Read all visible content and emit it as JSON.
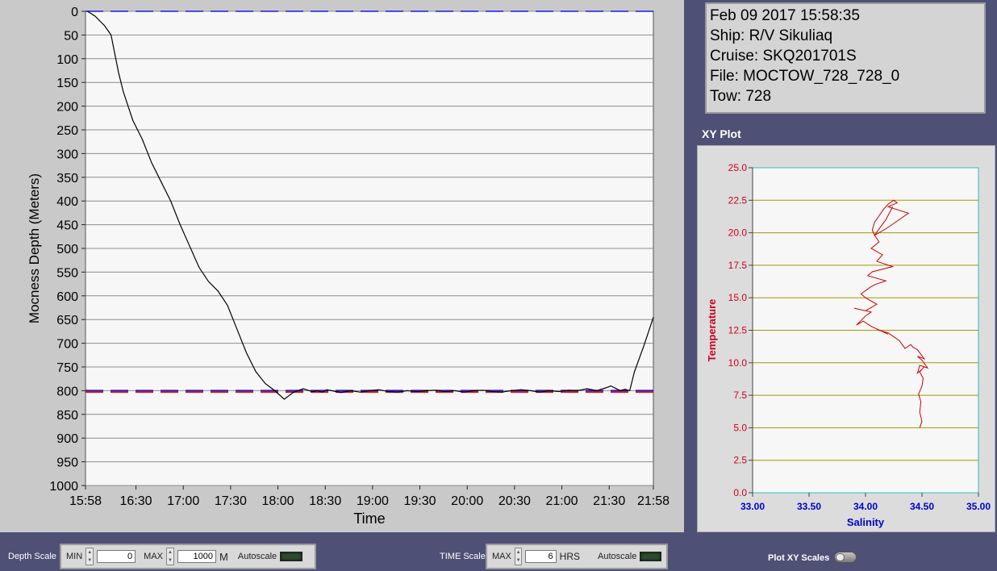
{
  "info": {
    "datetime": "Feb 09 2017 15:58:35",
    "ship": "Ship: R/V Sikuliaq",
    "cruise": "Cruise: SKQ201701S",
    "file": "File: MOCTOW_728_728_0",
    "tow": "Tow: 728"
  },
  "xy_title": "XY Plot",
  "controls": {
    "depth_scale_label": "Depth Scale",
    "min_label": "MIN",
    "min_value": "0",
    "max_label": "MAX",
    "max_value": "1000",
    "depth_unit": "M",
    "autoscale_label": "Autoscale",
    "time_scale_label": "TIME Scale",
    "time_max_label": "MAX",
    "time_max_value": "6",
    "time_unit": "HRS",
    "time_autoscale_label": "Autoscale",
    "plot_xy_scales_label": "Plot XY Scales"
  },
  "colors": {
    "panel_bg": "#4e5075",
    "plot_bg": "#f7f7f7",
    "depth_trace": "#000000",
    "target_line_blue": "#1a1ae6",
    "target_line_red": "#cc1a1a",
    "xy_trace": "#cc0000",
    "xy_grid": "#a09a00",
    "xy_y_label": "#cc0022",
    "xy_x_label": "#0000cc"
  },
  "chart_data": [
    {
      "type": "line",
      "xlabel": "Time",
      "ylabel": "Mocness Depth (Meters)",
      "ylim": [
        0,
        1000
      ],
      "y_inverted": true,
      "yticks": [
        "0",
        "50",
        "100",
        "150",
        "200",
        "250",
        "300",
        "350",
        "400",
        "450",
        "500",
        "550",
        "600",
        "650",
        "700",
        "750",
        "800",
        "850",
        "900",
        "950",
        "1000"
      ],
      "xtick_labels": [
        "15:58",
        "16:30",
        "17:00",
        "17:30",
        "18:00",
        "18:30",
        "19:00",
        "19:30",
        "20:00",
        "20:30",
        "21:00",
        "21:30",
        "21:58"
      ],
      "xtick_hours": [
        0,
        0.533,
        1.033,
        1.533,
        2.033,
        2.533,
        3.033,
        3.533,
        4.033,
        4.533,
        5.033,
        5.533,
        6.0
      ],
      "xlim_hours": [
        0,
        6
      ],
      "grid": true,
      "reference_lines": [
        {
          "depth": 0,
          "style": "dashed",
          "color": "blue"
        },
        {
          "depth": 800,
          "style": "dashed",
          "color": "blue"
        },
        {
          "depth": 803,
          "style": "dashed",
          "color": "red"
        }
      ],
      "series": [
        {
          "x_hours": [
            0.02,
            0.1,
            0.2,
            0.27,
            0.3,
            0.35,
            0.4,
            0.5,
            0.6,
            0.7,
            0.8,
            0.9,
            1.0,
            1.1,
            1.2,
            1.3,
            1.4,
            1.5,
            1.6,
            1.7,
            1.8,
            1.9,
            2.0,
            2.1,
            2.2,
            2.3,
            2.4,
            2.45,
            2.5,
            2.55,
            2.6,
            2.7,
            2.8,
            2.9,
            3.0,
            3.1,
            3.2,
            3.3,
            3.4,
            3.5,
            3.6,
            3.7,
            3.8,
            3.9,
            4.0,
            4.1,
            4.2,
            4.3,
            4.4,
            4.5,
            4.6,
            4.7,
            4.8,
            4.9,
            5.0,
            5.1,
            5.2,
            5.3,
            5.4,
            5.5,
            5.55,
            5.6,
            5.65,
            5.7,
            5.75,
            5.8,
            5.9,
            6.0
          ],
          "y_depth": [
            0,
            10,
            30,
            50,
            80,
            130,
            170,
            230,
            270,
            320,
            360,
            400,
            450,
            495,
            540,
            570,
            590,
            620,
            670,
            720,
            760,
            785,
            800,
            818,
            803,
            796,
            802,
            800,
            803,
            798,
            800,
            804,
            800,
            803,
            800,
            798,
            802,
            803,
            800,
            802,
            800,
            799,
            802,
            800,
            803,
            800,
            799,
            802,
            803,
            800,
            798,
            800,
            803,
            800,
            802,
            799,
            800,
            796,
            800,
            794,
            790,
            795,
            800,
            797,
            800,
            760,
            705,
            645
          ]
        }
      ]
    },
    {
      "type": "line",
      "xlabel": "Salinity",
      "ylabel": "Temperature",
      "xlim": [
        33.0,
        35.0
      ],
      "ylim": [
        0.0,
        25.0
      ],
      "xtick_labels": [
        "33.00",
        "33.50",
        "34.00",
        "34.50",
        "35.00"
      ],
      "ytick_labels": [
        "0.0",
        "2.5",
        "5.0",
        "7.5",
        "10.0",
        "12.5",
        "15.0",
        "17.5",
        "20.0",
        "22.5",
        "25.0"
      ],
      "series": [
        {
          "x": [
            34.48,
            34.5,
            34.48,
            34.49,
            34.47,
            34.5,
            34.51,
            34.48,
            34.52,
            34.5,
            34.46,
            34.48,
            34.55,
            34.5,
            34.46,
            34.52,
            34.46,
            34.42,
            34.4,
            34.35,
            34.3,
            34.25,
            34.2,
            34.12,
            34.1,
            34.2,
            34.05,
            33.98,
            33.92,
            34.0,
            34.05,
            33.9,
            34.0,
            34.1,
            34.0,
            33.96,
            34.04,
            34.08,
            34.18,
            34.02,
            34.06,
            34.24,
            34.1,
            34.15,
            34.05,
            34.12,
            34.08,
            34.18,
            34.38,
            34.2,
            34.28,
            34.25,
            34.2,
            34.16,
            34.12,
            34.08,
            34.06,
            34.08,
            34.12,
            34.18,
            34.24
          ],
          "y": [
            5.0,
            5.5,
            6.2,
            7.0,
            7.6,
            8.2,
            8.8,
            9.3,
            9.7,
            9.5,
            9.2,
            9.8,
            9.6,
            10.2,
            10.5,
            10.3,
            11.0,
            11.2,
            11.4,
            11.1,
            11.7,
            12.0,
            12.3,
            12.5,
            12.6,
            12.2,
            12.8,
            13.2,
            12.9,
            13.6,
            13.9,
            14.2,
            14.0,
            14.5,
            15.0,
            15.3,
            15.8,
            16.0,
            16.3,
            16.7,
            17.0,
            17.4,
            17.8,
            18.3,
            18.8,
            19.3,
            19.8,
            20.3,
            21.5,
            22.0,
            22.3,
            22.5,
            22.2,
            21.8,
            21.3,
            20.8,
            20.2,
            19.8,
            20.3,
            21.0,
            22.0
          ]
        }
      ]
    }
  ]
}
